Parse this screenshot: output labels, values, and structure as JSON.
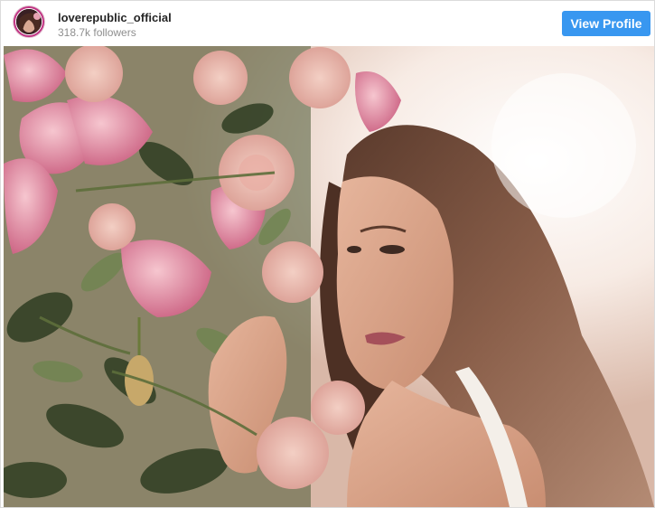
{
  "header": {
    "username": "loverepublic_official",
    "followers": "318.7k followers",
    "view_profile_label": "View Profile"
  },
  "avatar": {
    "icon": "profile-avatar"
  },
  "post": {
    "image": "woman-with-roses-photo"
  },
  "colors": {
    "accent": "#3897f0",
    "username_text": "#262626",
    "muted_text": "#8e8e8e"
  }
}
